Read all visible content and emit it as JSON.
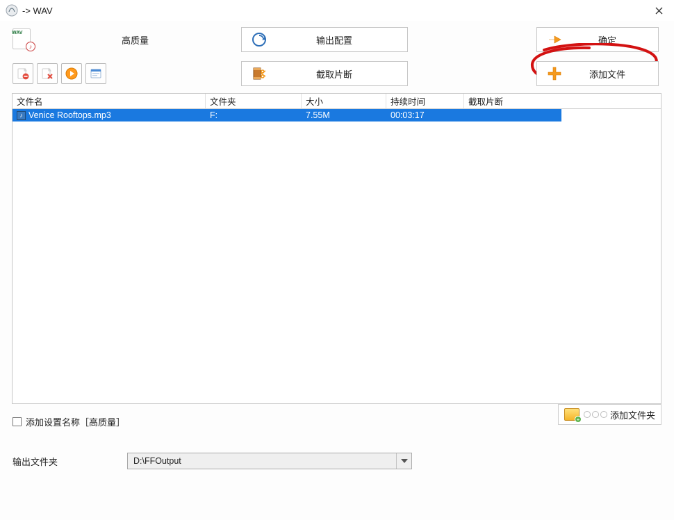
{
  "titlebar": {
    "title": "-> WAV",
    "wav_tag": "WAV"
  },
  "toprow": {
    "quality_label": "高质量",
    "output_config_label": "输出配置",
    "confirm_label": "确定"
  },
  "secondrow": {
    "cut_clip_label": "截取片断",
    "add_file_label": "添加文件"
  },
  "icons": {
    "remove_one": "remove-item",
    "clear_all": "clear-all",
    "play": "play",
    "info": "info"
  },
  "table": {
    "headers": {
      "name": "文件名",
      "folder": "文件夹",
      "size": "大小",
      "duration": "持续时间",
      "clip": "截取片断"
    },
    "rows": [
      {
        "name": "Venice Rooftops.mp3",
        "folder": "F:",
        "size": "7.55M",
        "duration": "00:03:17",
        "clip": "",
        "selected": true
      }
    ]
  },
  "bottom": {
    "add_preset_label": "添加设置名称［高质量］",
    "add_folder_label": "添加文件夹",
    "output_folder_label": "输出文件夹",
    "output_folder_value": "D:\\FFOutput"
  }
}
